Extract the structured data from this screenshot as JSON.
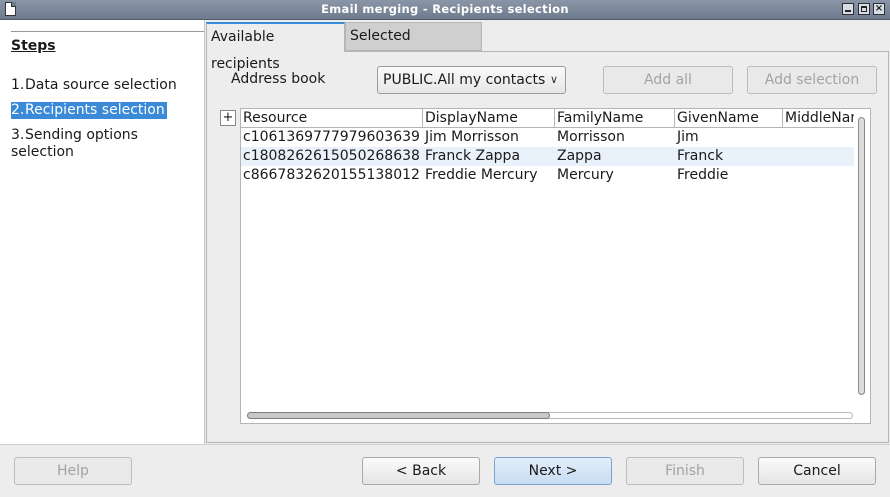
{
  "window": {
    "title": "Email merging - Recipients selection",
    "close_glyph": "×"
  },
  "steps": {
    "title": "Steps",
    "items": [
      {
        "num": "1.",
        "label": "Data source selection"
      },
      {
        "num": "2.",
        "label": "Recipients selection",
        "selected": true
      },
      {
        "num": "3.",
        "label": "Sending options selection"
      }
    ]
  },
  "tabs": [
    {
      "label": "Available recipients",
      "active": true
    },
    {
      "label": "Selected recipients",
      "active": false
    }
  ],
  "address_book": {
    "label": "Address book",
    "value": "PUBLIC.All my contacts",
    "arrow": "∨"
  },
  "actions": {
    "add_all": "Add all",
    "add_selection": "Add selection",
    "expand": "+"
  },
  "grid": {
    "columns": [
      "Resource",
      "DisplayName",
      "FamilyName",
      "GivenName",
      "MiddleName"
    ],
    "rows": [
      [
        "c1061369777979603639",
        "Jim Morrisson",
        "Morrisson",
        "Jim",
        ""
      ],
      [
        "c1808262615050268638",
        "Franck Zappa",
        "Zappa",
        "Franck",
        ""
      ],
      [
        "c8667832620155138012",
        "Freddie Mercury",
        "Mercury",
        "Freddie",
        ""
      ]
    ],
    "highlighted_row": 1
  },
  "buttons": {
    "help": "Help",
    "back": "< Back",
    "next": "Next >",
    "finish": "Finish",
    "cancel": "Cancel"
  },
  "colors": {
    "selection": "#3a8ad8",
    "titlebar": "#7a8598"
  }
}
